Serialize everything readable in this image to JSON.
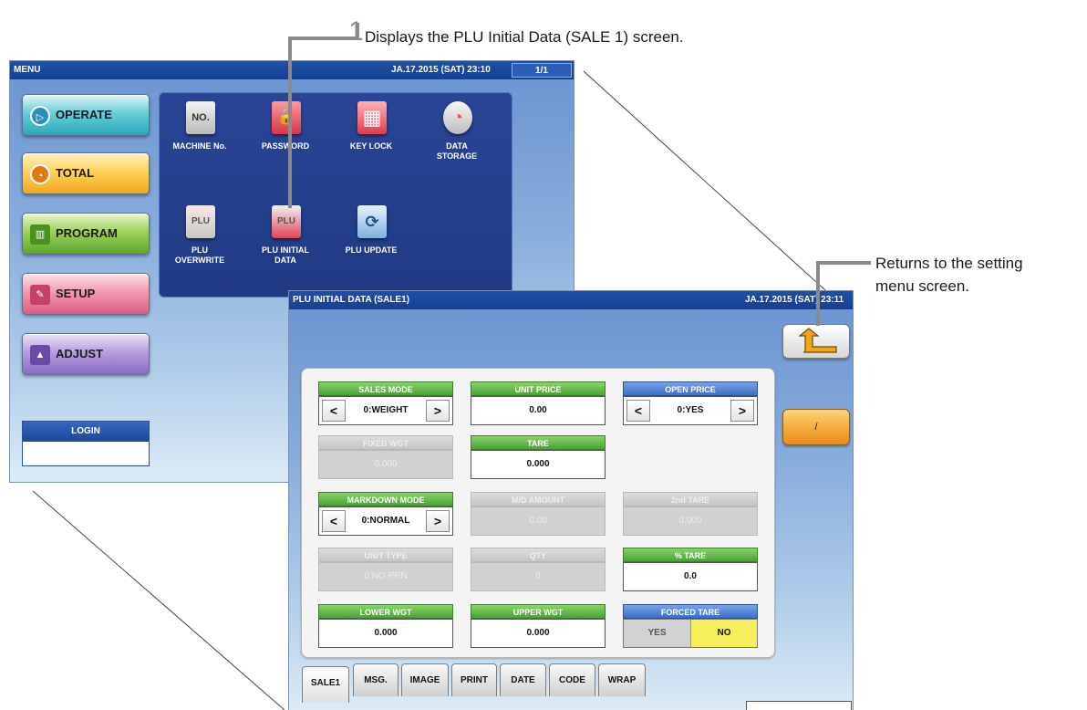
{
  "callouts": {
    "step_number": "1",
    "step_text": "Displays the PLU Initial Data (SALE 1) screen.",
    "return_text_line1": "Returns to the setting",
    "return_text_line2": "menu screen."
  },
  "menu_screen": {
    "title": "MENU",
    "datetime": "JA.17.2015 (SAT)  23:10",
    "page": "1/1",
    "buttons": [
      {
        "label": "OPERATE",
        "icon": "play-icon"
      },
      {
        "label": "TOTAL",
        "icon": "clock-icon"
      },
      {
        "label": "PROGRAM",
        "icon": "book-icon"
      },
      {
        "label": "SETUP",
        "icon": "wrench-icon"
      },
      {
        "label": "ADJUST",
        "icon": "scale-icon"
      }
    ],
    "login_label": "LOGIN",
    "tiles": [
      {
        "label": "MACHINE No.",
        "icon_text": "NO."
      },
      {
        "label": "PASSWORD",
        "icon_text": "🔒"
      },
      {
        "label": "KEY LOCK",
        "icon_text": "▦"
      },
      {
        "label": "DATA\nSTORAGE",
        "icon_text": "◔"
      },
      {
        "label": "PLU\nOVERWRITE",
        "icon_text": "PLU"
      },
      {
        "label": "PLU INITIAL\nDATA",
        "icon_text": "PLU"
      },
      {
        "label": "PLU UPDATE",
        "icon_text": "⟳"
      }
    ],
    "colors": {
      "titlebar": "#1f4fa6",
      "icon_panel": "#243d88"
    }
  },
  "setting_screen": {
    "title": "PLU INITIAL DATA (SALE1)",
    "datetime": "JA.17.2015 (SAT)  23:11",
    "side_button_label": "/",
    "fields": {
      "sales_mode": {
        "header": "SALES MODE",
        "value": "0:WEIGHT"
      },
      "unit_price": {
        "header": "UNIT PRICE",
        "value": "0.00"
      },
      "open_price": {
        "header": "OPEN PRICE",
        "value": "0:YES"
      },
      "fixed_wgt": {
        "header": "FIXED WGT",
        "value": "0.000"
      },
      "tare": {
        "header": "TARE",
        "value": "0.000"
      },
      "markdown_mode": {
        "header": "MARKDOWN MODE",
        "value": "0:NORMAL"
      },
      "md_amount": {
        "header": "M/D AMOUNT",
        "value": "0.00"
      },
      "second_tare": {
        "header": "2nd TARE",
        "value": "0.000"
      },
      "unit_type": {
        "header": "UNIT TYPE",
        "value": "0:NO PRN"
      },
      "qty": {
        "header": "QTY",
        "value": "0"
      },
      "pct_tare": {
        "header": "% TARE",
        "value": "0.0"
      },
      "lower_wgt": {
        "header": "LOWER WGT",
        "value": "0.000"
      },
      "upper_wgt": {
        "header": "UPPER WGT",
        "value": "0.000"
      },
      "forced_tare": {
        "header": "FORCED TARE",
        "yes": "YES",
        "no": "NO",
        "selected": "NO"
      }
    },
    "tabs": [
      "SALE1",
      "MSG.",
      "IMAGE",
      "PRINT",
      "DATE",
      "CODE",
      "WRAP"
    ],
    "active_tab": "SALE1",
    "colors": {
      "field_header_green": "#4aa236",
      "field_header_blue": "#3b6ec9",
      "selected_yellow": "#f6ee5a",
      "side_button_orange": "#f5a83a"
    }
  }
}
